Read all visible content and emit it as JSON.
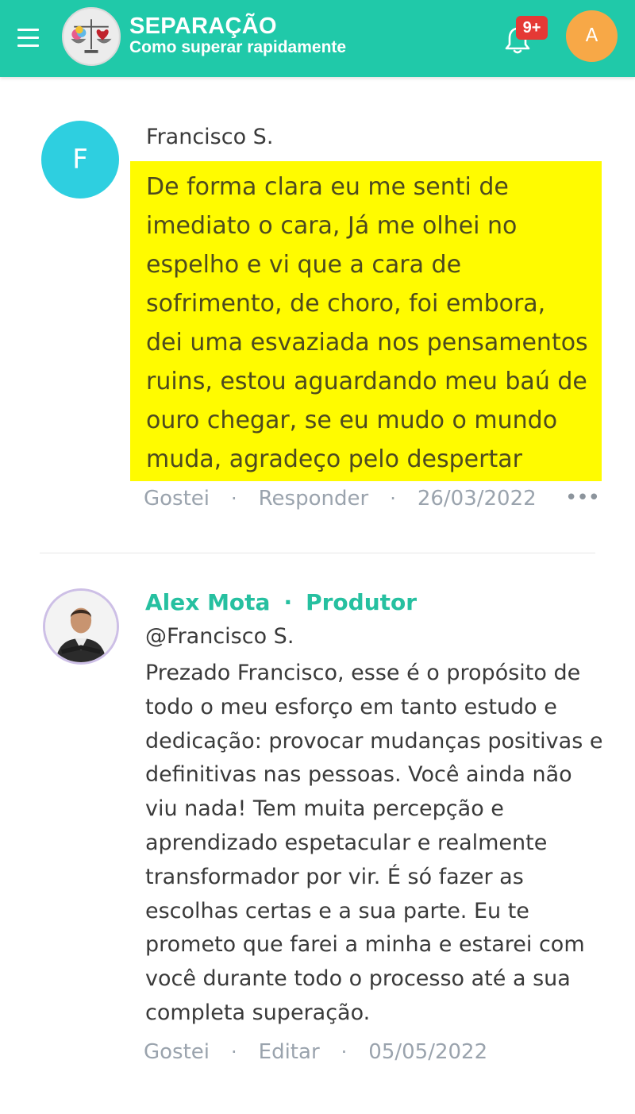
{
  "header": {
    "title": "SEPARAÇÃO",
    "subtitle": "Como superar rapidamente",
    "notification_badge": "9+",
    "user_initial": "A",
    "accent_color": "#20c9a9",
    "icons": [
      "menu-icon",
      "logo-icon",
      "bell-icon"
    ]
  },
  "comments": [
    {
      "avatar_initial": "F",
      "author": "Francisco S.",
      "text": "De forma clara eu me senti de\nimediato o cara, Já  me olhei no\nespelho e vi que a cara de\nsofrimento, de choro, foi embora,\ndei uma esvaziada nos pensamentos\nruins, estou aguardando meu baú de\nouro chegar, se eu mudo o mundo\nmuda, agradeço pelo despertar",
      "like_label": "Gostei",
      "reply_label": "Responder",
      "date": "26/03/2022",
      "more_label": "•••",
      "highlight_color": "#fffb00"
    },
    {
      "author": "Alex Mota",
      "role": "Produtor",
      "mention": "@Francisco S.",
      "text": "Prezado Francisco, esse é o propósito de\ntodo o meu esforço em tanto estudo e\ndedicação: provocar mudanças positivas e\ndefinitivas nas pessoas. Você ainda não\nviu nada! Tem muita percepção e\naprendizado espetacular e realmente\ntransformador por vir. É só fazer as\nescolhas certas e a sua parte. Eu te\nprometo que farei a minha e estarei com\nvocê durante todo o processo até a sua\ncompleta superação.",
      "like_label": "Gostei",
      "edit_label": "Editar",
      "date": "05/05/2022"
    }
  ]
}
